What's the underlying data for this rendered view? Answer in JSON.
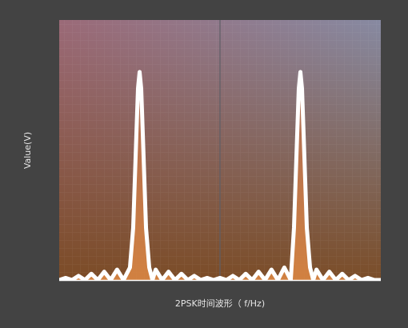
{
  "chart_data": {
    "type": "area",
    "title": "",
    "xlabel": "2PSK时间波形（ f/Hz)",
    "ylabel": "Value(V)",
    "xlim": [
      0,
      1000
    ],
    "ylim": [
      0,
      1.25
    ],
    "grid": true,
    "legend": "none",
    "series": [
      {
        "values_x": [
          0,
          20,
          40,
          60,
          80,
          100,
          120,
          140,
          160,
          180,
          200,
          220,
          230,
          240,
          245,
          250,
          255,
          260,
          270,
          280,
          290,
          300,
          320,
          340,
          360,
          380,
          400,
          420,
          440,
          460,
          480,
          500,
          520,
          540,
          560,
          580,
          600,
          620,
          640,
          660,
          680,
          700,
          720,
          730,
          740,
          745,
          750,
          755,
          760,
          770,
          780,
          790,
          800,
          820,
          840,
          860,
          880,
          900,
          920,
          940,
          960,
          980,
          1000
        ],
        "values_y": [
          0.0,
          0.01,
          0.0,
          0.02,
          0.0,
          0.03,
          0.0,
          0.04,
          0.0,
          0.05,
          0.0,
          0.06,
          0.25,
          0.7,
          0.92,
          1.0,
          0.92,
          0.7,
          0.25,
          0.06,
          0.0,
          0.05,
          0.0,
          0.04,
          0.0,
          0.03,
          0.0,
          0.02,
          0.0,
          0.01,
          0.0,
          0.01,
          0.0,
          0.02,
          0.0,
          0.03,
          0.0,
          0.04,
          0.0,
          0.05,
          0.0,
          0.06,
          0.0,
          0.25,
          0.7,
          0.92,
          1.0,
          0.92,
          0.7,
          0.25,
          0.06,
          0.0,
          0.05,
          0.0,
          0.04,
          0.0,
          0.03,
          0.0,
          0.02,
          0.0,
          0.01,
          0.0,
          0.0
        ]
      }
    ],
    "colors": {
      "page_bg": "#434343",
      "plot_bg_top_left": "#9b6a78",
      "plot_bg_top_right": "#8a8aa0",
      "plot_bg_bottom": "#7a4a22",
      "line": "#ffffff",
      "fill": "#e08a45",
      "axis_text": "#e6e6e6"
    }
  }
}
